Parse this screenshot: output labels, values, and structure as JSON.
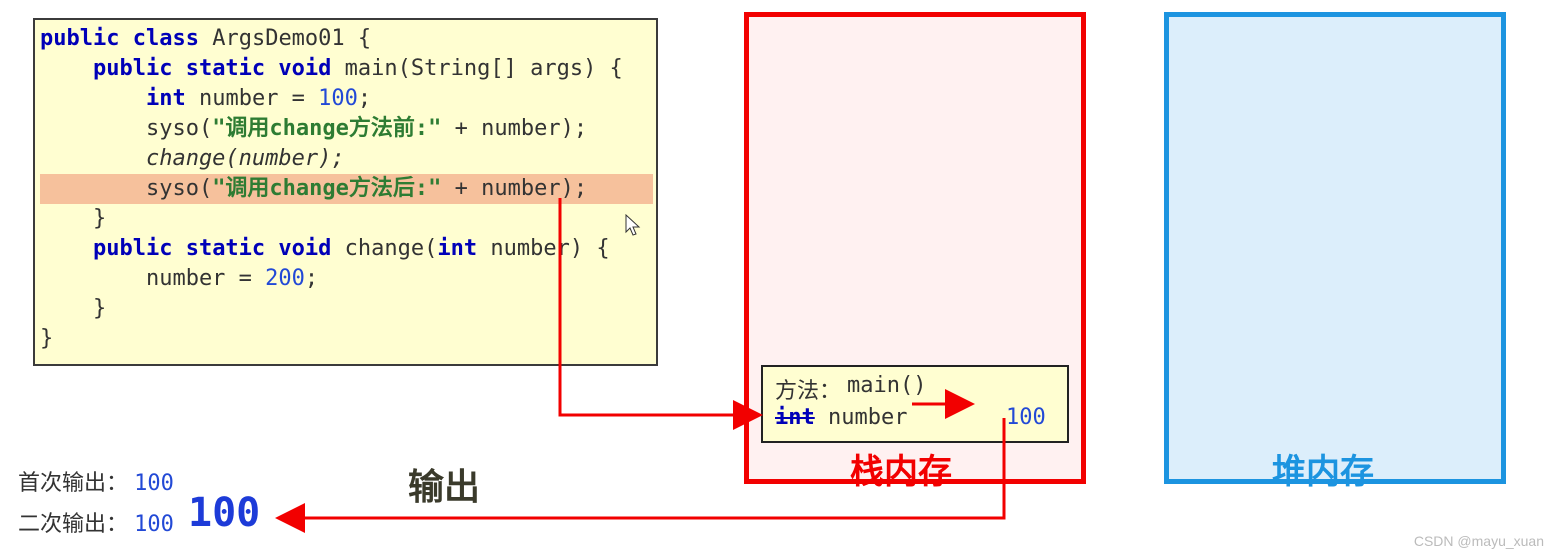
{
  "code": {
    "line1_kw1": "public",
    "line1_kw2": "class",
    "line1_name": " ArgsDemo01 {",
    "line2_pre": "    ",
    "line2_kw": "public static void",
    "line2_rest": " main(String[] args) {",
    "line3_pre": "        ",
    "line3_kw": "int",
    "line3_var": " number = ",
    "line3_num": "100",
    "line3_end": ";",
    "line4_pre": "        syso(",
    "line4_str": "\"调用change方法前:\"",
    "line4_rest": " + number);",
    "line5": "        change(number);",
    "line6_pre": "        syso(",
    "line6_str": "\"调用change方法后:\"",
    "line6_rest": " + number);",
    "line7": "    }",
    "line8_pre": "    ",
    "line8_kw": "public static void",
    "line8_name": " change(",
    "line8_int": "int",
    "line8_rest": " number) {",
    "line9_pre": "        number = ",
    "line9_num": "200",
    "line9_end": ";",
    "line10": "    }",
    "line11": "}"
  },
  "stack": {
    "frame_label": "方法：",
    "frame_method": "main()",
    "int_kw": "int",
    "var_name": "number",
    "var_value": "100",
    "title": "栈内存"
  },
  "heap": {
    "title": "堆内存"
  },
  "output": {
    "label": "输出",
    "first_label": "首次输出：",
    "first_value": "100",
    "second_label": "二次输出：",
    "second_value": "100",
    "big_value": "100"
  },
  "watermark": "CSDN @mayu_xuan"
}
